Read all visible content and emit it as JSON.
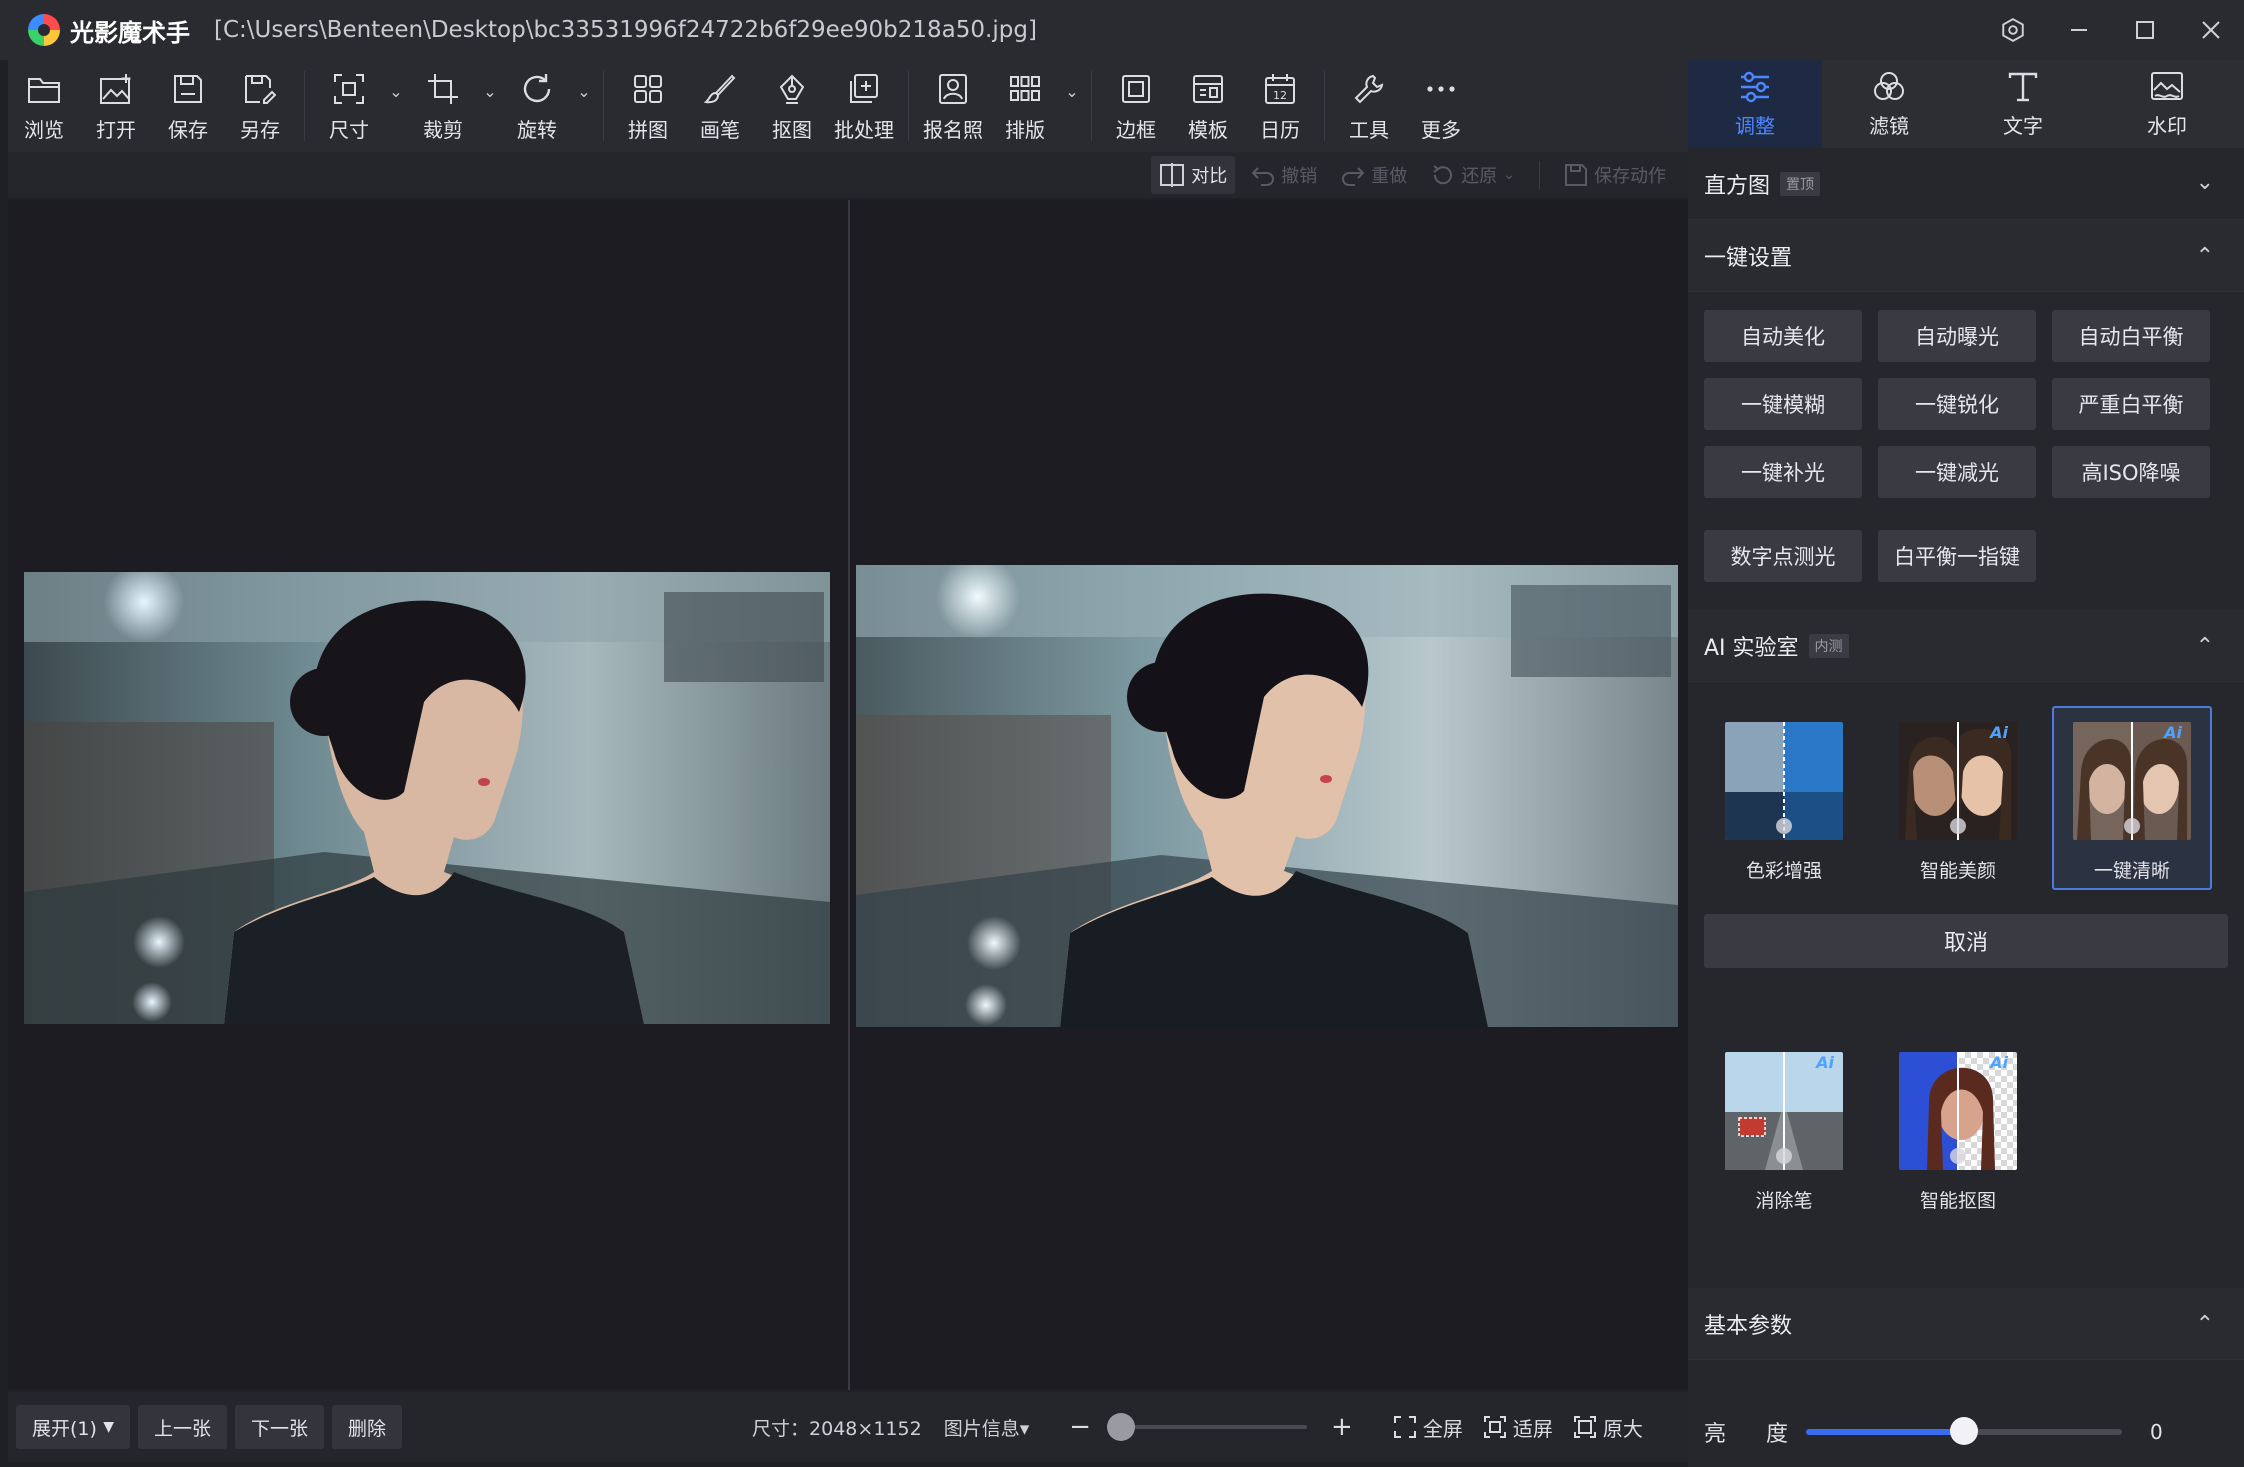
{
  "window": {
    "app_name": "光影魔术手",
    "file_path": "[C:\\Users\\Benteen\\Desktop\\bc33531996f24722b6f29ee90b218a50.jpg]",
    "controls": [
      "settings-icon",
      "minimize-icon",
      "maximize-icon",
      "close-icon"
    ]
  },
  "toolbar": {
    "browse": "浏览",
    "open": "打开",
    "save": "保存",
    "save_as": "另存",
    "size": "尺寸",
    "crop": "裁剪",
    "rotate": "旋转",
    "collage": "拼图",
    "brush": "画笔",
    "cutout": "抠图",
    "batch": "批处理",
    "id_photo": "报名照",
    "layout": "排版",
    "border": "边框",
    "template": "模板",
    "calendar": "日历",
    "tools": "工具",
    "more": "更多"
  },
  "subbar": {
    "compare": "对比",
    "undo": "撤销",
    "redo": "重做",
    "restore": "还原",
    "save_action": "保存动作"
  },
  "bottombar": {
    "expand": "展开(1)",
    "prev": "上一张",
    "next": "下一张",
    "delete": "删除",
    "size_label": "尺寸：2048×1152",
    "image_info": "图片信息▾",
    "zoom_level": 0.0,
    "fullscreen": "全屏",
    "fit": "适屏",
    "original": "原大"
  },
  "panel": {
    "tabs": [
      {
        "label": "调整",
        "icon": "sliders-icon",
        "active": true
      },
      {
        "label": "滤镜",
        "icon": "filter-circles-icon",
        "active": false
      },
      {
        "label": "文字",
        "icon": "text-icon",
        "active": false
      },
      {
        "label": "水印",
        "icon": "watermark-icon",
        "active": false
      }
    ],
    "histogram": {
      "title": "直方图",
      "tag": "置顶"
    },
    "quick": {
      "title": "一键设置",
      "buttons": [
        "自动美化",
        "自动曝光",
        "自动白平衡",
        "一键模糊",
        "一键锐化",
        "严重白平衡",
        "一键补光",
        "一键减光",
        "高ISO降噪"
      ],
      "extra": [
        "数字点测光",
        "白平衡一指键"
      ]
    },
    "ai_lab": {
      "title": "AI 实验室",
      "tag": "内测",
      "items": [
        "色彩增强",
        "智能美颜",
        "一键清晰"
      ],
      "selected_index": 2,
      "cancel": "取消",
      "more_items": [
        "消除笔",
        "智能抠图"
      ]
    },
    "basic": {
      "title": "基本参数",
      "brightness_label_1": "亮",
      "brightness_label_2": "度",
      "brightness_value": "0"
    }
  },
  "colors": {
    "accent": "#3a6cf0",
    "tab_active_bg": "#1e2a44",
    "panel_bg": "#26262d"
  }
}
